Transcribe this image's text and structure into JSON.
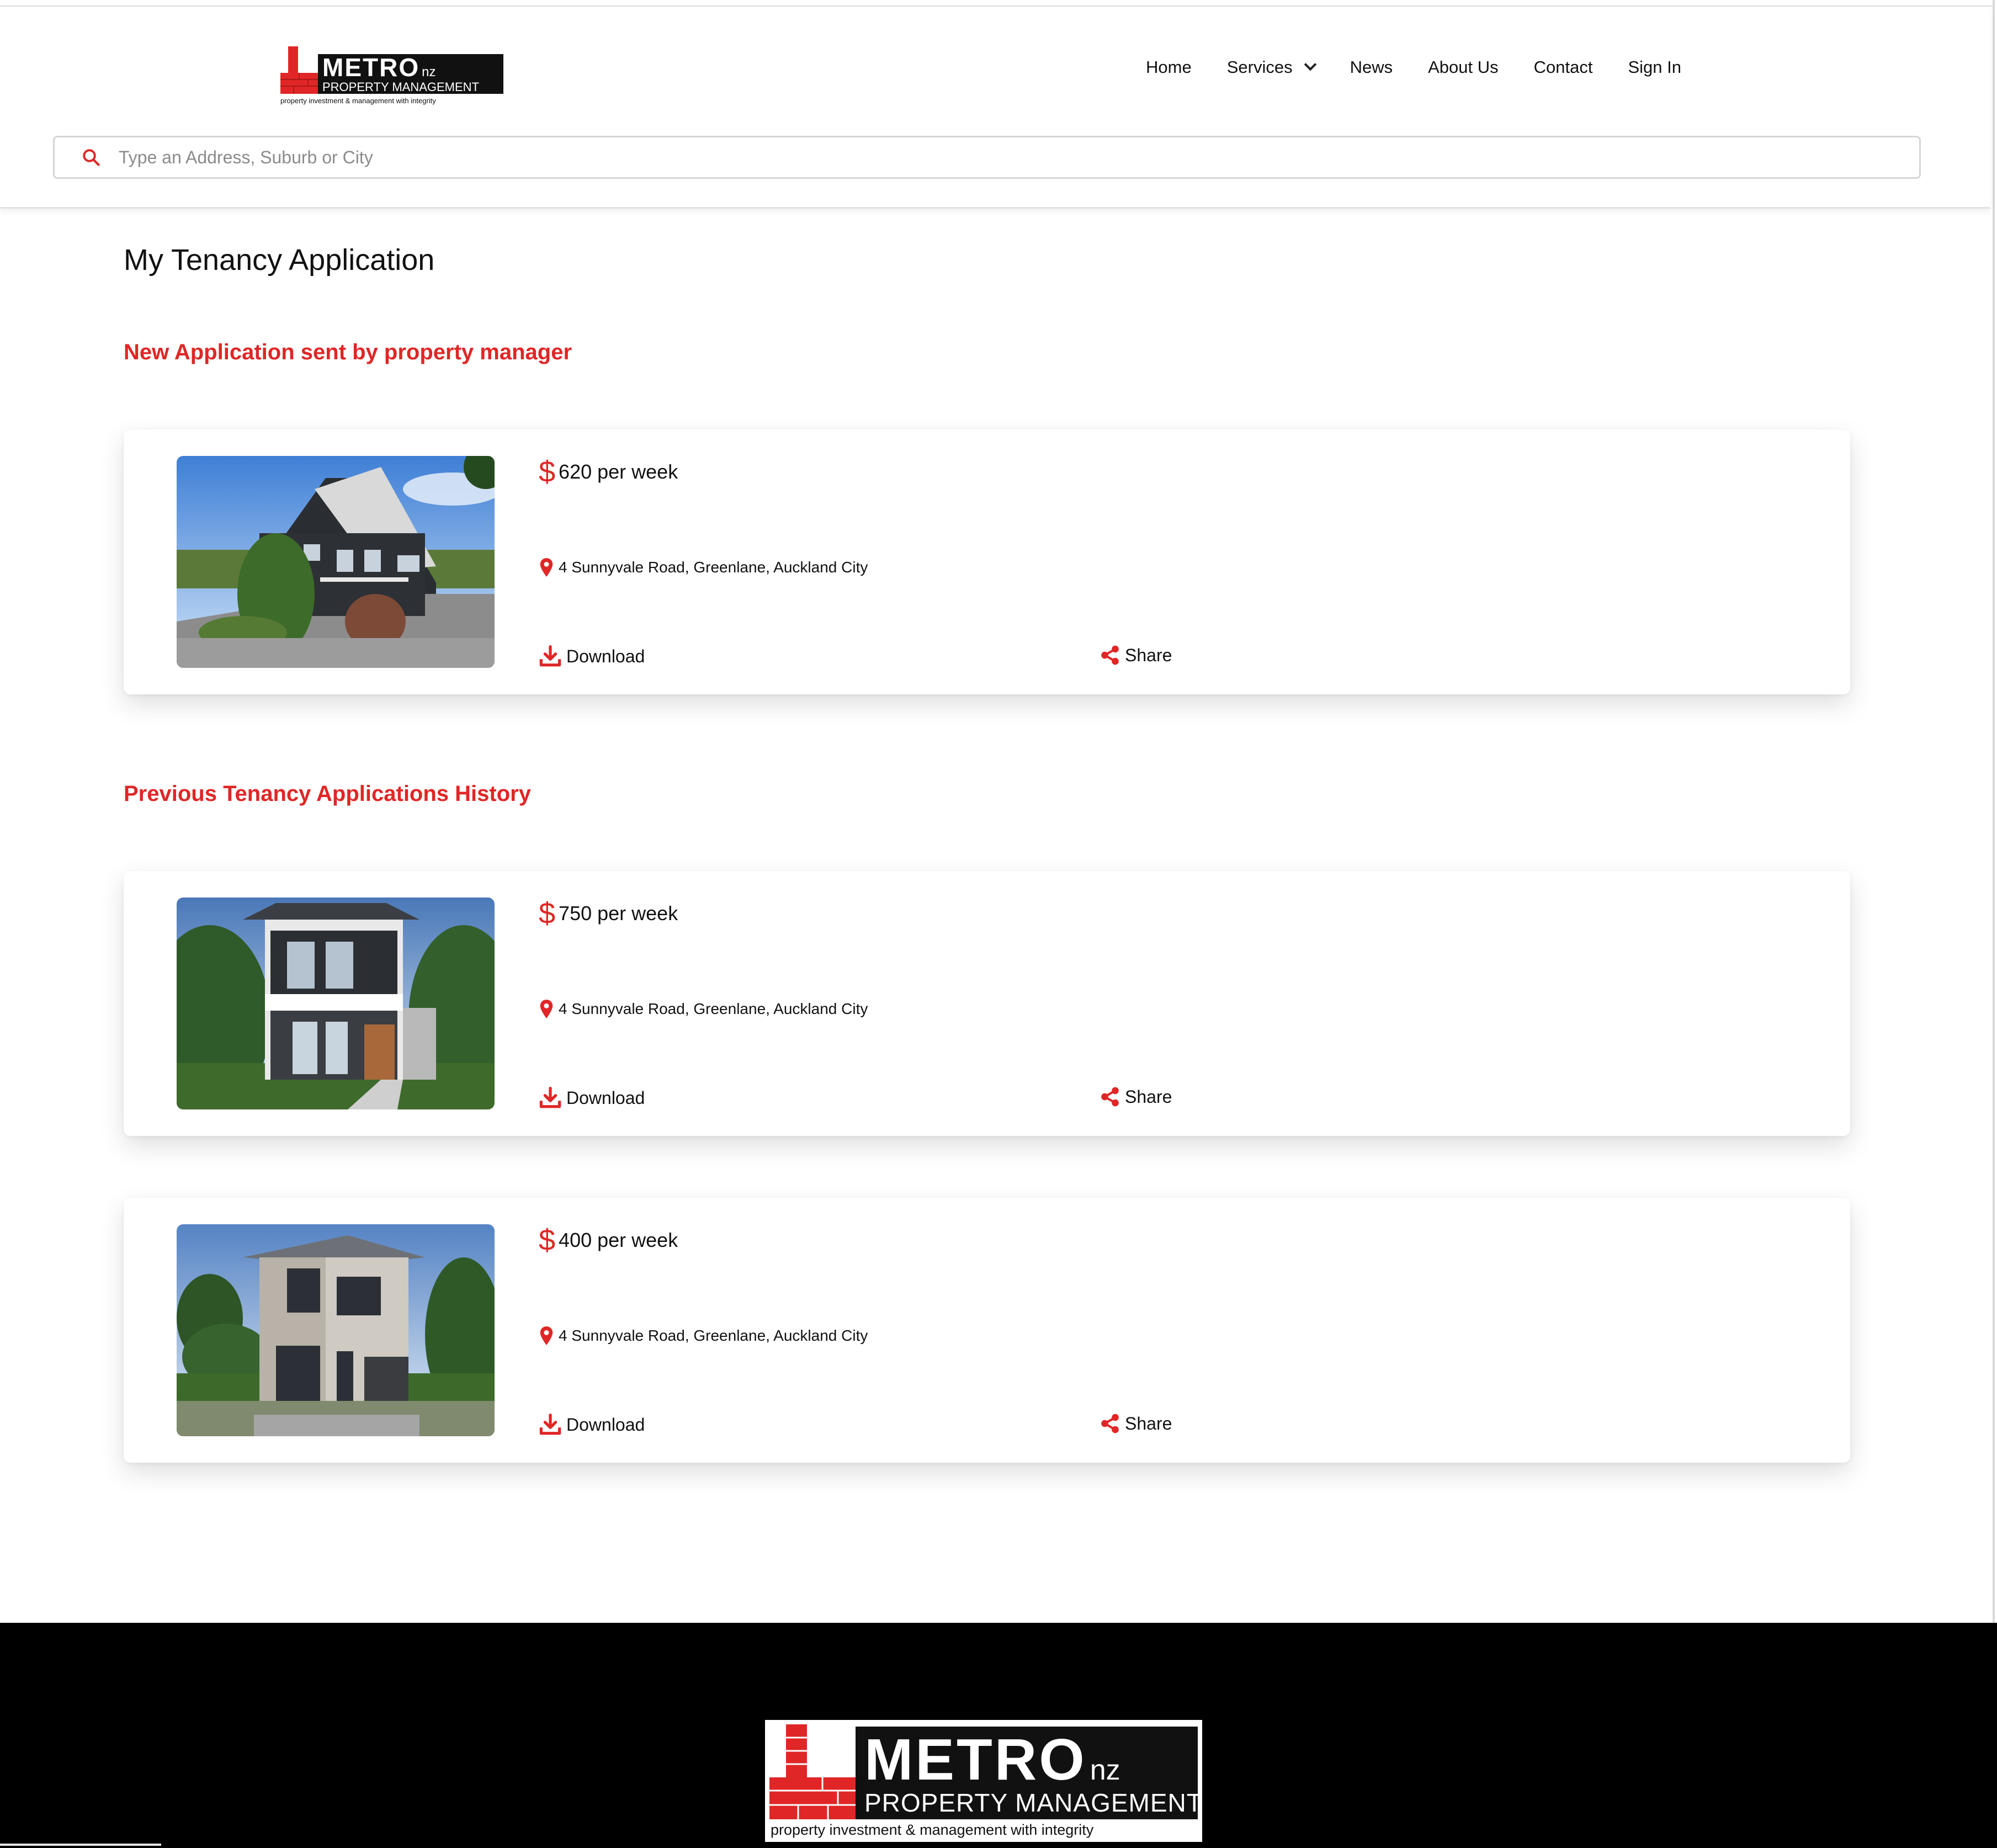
{
  "brand": {
    "logo_text": "METRO",
    "logo_suffix": "nz",
    "logo_subtitle": "PROPERTY MANAGEMENT",
    "tagline": "property investment & management with integrity",
    "accent_color": "#e02626"
  },
  "nav": {
    "items": [
      {
        "label": "Home"
      },
      {
        "label": "Services",
        "icon": "chevron-down-icon"
      },
      {
        "label": "News"
      },
      {
        "label": "About Us"
      },
      {
        "label": "Contact"
      },
      {
        "label": "Sign In"
      }
    ]
  },
  "search": {
    "placeholder": "Type an Address, Suburb or City",
    "value": "",
    "icon": "search-icon"
  },
  "page": {
    "title": "My Tenancy Application",
    "new_section_heading": "New Application sent by property manager",
    "history_section_heading": "Previous Tenancy Applications History"
  },
  "new_application": {
    "currency_symbol": "$",
    "price": "620 per week",
    "address": "4 Sunnyvale Road, Greenlane, Auckland City",
    "download_label": "Download",
    "share_label": "Share",
    "image": "house-photo-dark-cladding"
  },
  "history": [
    {
      "currency_symbol": "$",
      "price": "750 per week",
      "address": "4 Sunnyvale Road, Greenlane, Auckland City",
      "download_label": "Download",
      "share_label": "Share",
      "image": "house-photo-modern-two-storey"
    },
    {
      "currency_symbol": "$",
      "price": "400 per week",
      "address": "4 Sunnyvale Road, Greenlane, Auckland City",
      "download_label": "Download",
      "share_label": "Share",
      "image": "house-photo-grey-townhouse"
    }
  ]
}
